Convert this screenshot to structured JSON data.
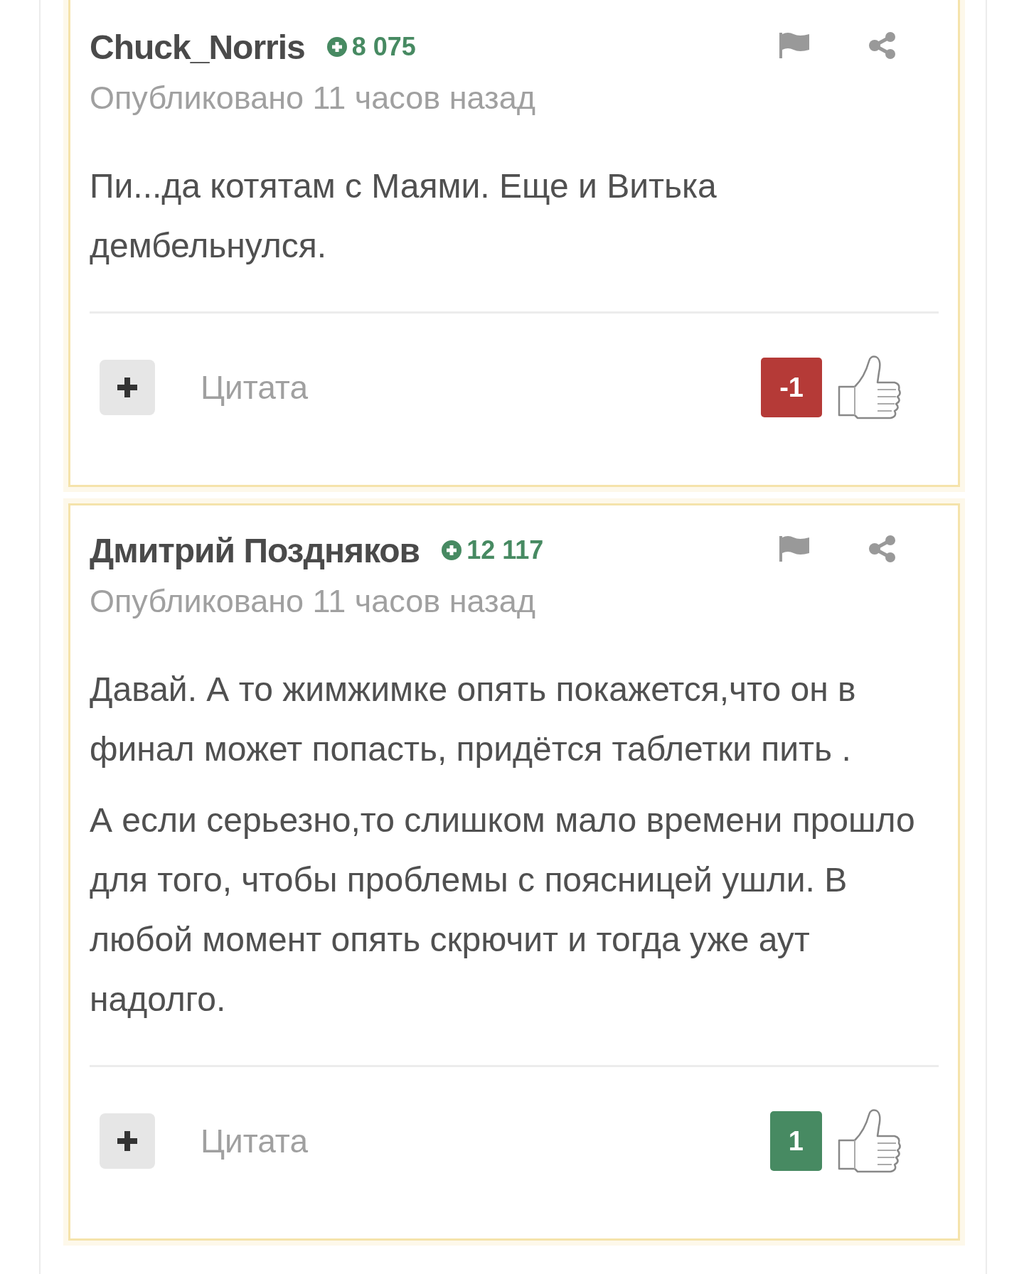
{
  "comments": [
    {
      "author": "Chuck_Norris",
      "rating": "8 075",
      "published": "Опубликовано 11 часов назад",
      "paragraphs": [
        "Пи...да котятам с Маями. Еще и Витька дембельнулся."
      ],
      "quote_label": "Цитата",
      "vote": {
        "value": "-1",
        "kind": "negative"
      }
    },
    {
      "author": "Дмитрий Поздняков",
      "rating": "12 117",
      "published": "Опубликовано 11 часов назад",
      "paragraphs": [
        "Давай. А то жимжимке опять покажется,что он в финал может попасть, придётся таблетки пить .",
        "А если серьезно,то слишком мало времени прошло для того, чтобы проблемы с поясницей ушли. В любой момент опять скрючит и тогда уже аут надолго."
      ],
      "quote_label": "Цитата",
      "vote": {
        "value": "1",
        "kind": "positive"
      }
    }
  ]
}
